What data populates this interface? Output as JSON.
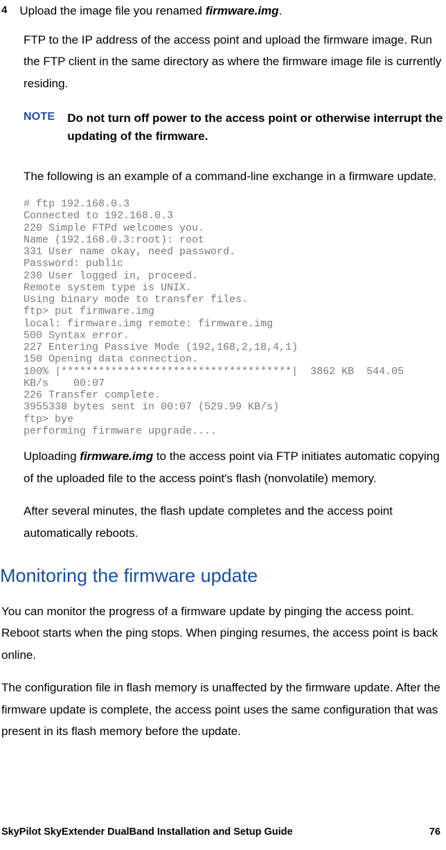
{
  "step": {
    "number": "4",
    "title_prefix": "Upload the image file you renamed ",
    "title_fname": "firmware.img",
    "title_suffix": "."
  },
  "para1": "FTP to the IP address of the access point and upload the firmware image. Run the FTP client in the same directory as where the firmware image file is currently residing.",
  "note": {
    "label": "NOTE",
    "body": "Do not turn off power to the access point or otherwise interrupt the updating of the firmware."
  },
  "para2": "The following is an example of a command-line exchange in a firmware update.",
  "code": "# ftp 192.168.0.3\nConnected to 192.168.0.3\n220 Simple FTPd welcomes you.\nName (192.168.0.3:root): root\n331 User name okay, need password.\nPassword: public\n230 User logged in, proceed.\nRemote system type is UNIX.\nUsing binary mode to transfer files.\nftp> put firmware.img\nlocal: firmware.img remote: firmware.img\n500 Syntax error.\n227 Entering Passive Mode (192,168,2,18,4,1)\n150 Opening data connection.\n100% |*************************************|  3862 KB  544.05 \nKB/s    00:07\n226 Transfer complete.\n3955338 bytes sent in 00:07 (529.99 KB/s)\nftp> bye\nperforming firmware upgrade....",
  "upload_para": {
    "prefix": "Uploading ",
    "fname": "firmware.img",
    "suffix": " to the access point via FTP initiates automatic copying of the uploaded file to the access point's flash (nonvolatile) memory."
  },
  "para3": "After several minutes, the flash update completes and the access point automatically reboots.",
  "h2": "Monitoring the firmware update",
  "body1": "You can monitor the progress of a firmware update by pinging the access point. Reboot starts when the ping stops. When pinging resumes, the access point is back online.",
  "body2": "The configuration file in flash memory is unaffected by the firmware update. After the firmware update is complete, the access point uses the same configuration that was present in its flash memory before the update.",
  "footer": {
    "title": "SkyPilot SkyExtender DualBand Installation and Setup Guide",
    "page": "76"
  }
}
